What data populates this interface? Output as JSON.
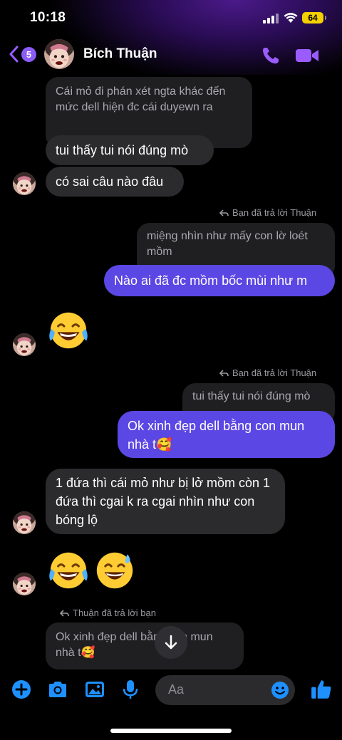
{
  "status": {
    "time": "10:18",
    "battery": "64"
  },
  "header": {
    "unread_count": "5",
    "contact_name": "Bích Thuận",
    "accent": "#9b5cff"
  },
  "messages": {
    "m1_quote": "Cái mỏ đi phán xét ngta khác đến mức dell hiện đc cái duyewn ra",
    "m2": "tui thấy tui nói đúng mò",
    "m3": "có sai câu nào đâu",
    "reply_note_1": "Bạn đã trả lời Thuận",
    "m4_quote": "miệng nhìn như mấy con lờ loét mồm",
    "m5": "Nào ai đã đc mồm bốc mùi như m",
    "reply_note_2": "Bạn đã trả lời Thuận",
    "m6_quote": "tui thấy tui nói đúng mò",
    "m7": "Ok xinh đẹp dell bằng con mun nhà t🥰",
    "m8": "1 đứa thì cái mỏ như bị lở mồm còn 1 đứa thì cgai k ra cgai nhìn như con bóng lộ",
    "reply_note_3": "Thuận đã trả lời bạn",
    "m9_quote": "Ok xinh đẹp dell bằng con mun nhà t🥰"
  },
  "composer": {
    "placeholder": "Aa"
  },
  "icons": {
    "emoji_1": "face-with-tears-of-joy",
    "emoji_2": "face-with-tears-of-joy",
    "emoji_3": "grinning-face-with-sweat",
    "toolbar": [
      "plus-icon",
      "camera-icon",
      "gallery-icon",
      "mic-icon",
      "thumbs-up-icon"
    ]
  }
}
